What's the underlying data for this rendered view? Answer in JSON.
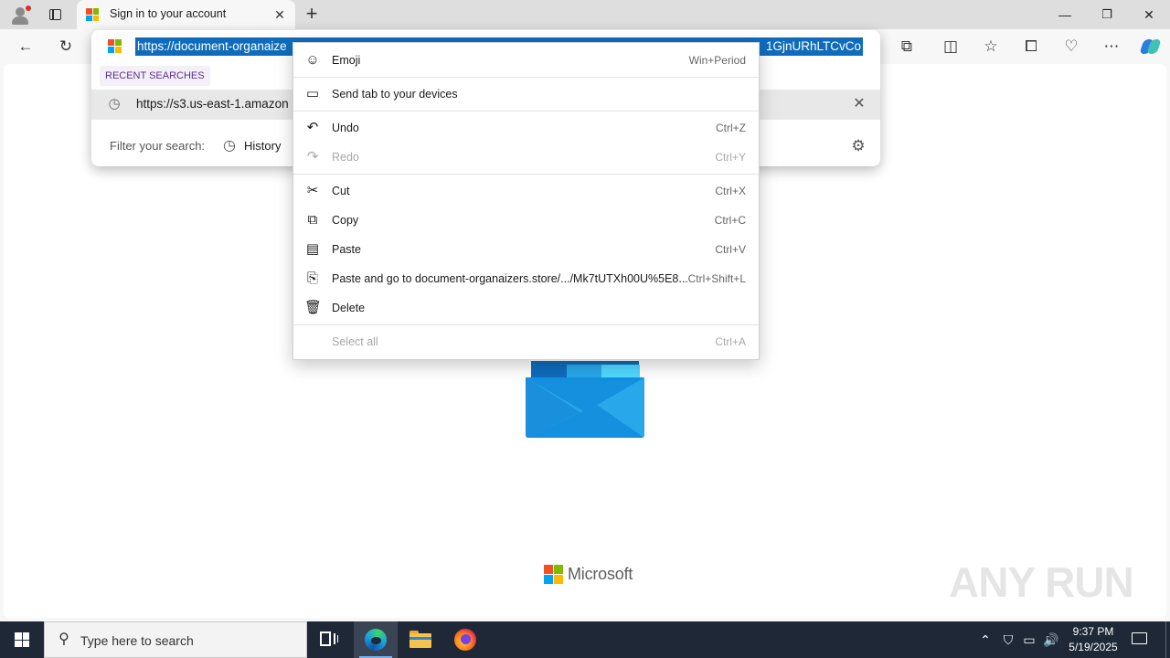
{
  "browser": {
    "tab": {
      "title": "Sign in to your account"
    },
    "window_controls": {
      "minimize": "—",
      "restore": "❐",
      "close": "✕"
    },
    "toolbar_icons": [
      "back-icon",
      "refresh-icon",
      "extensions-icon",
      "split-screen-icon",
      "favorites-icon",
      "collections-icon",
      "browser-essentials-icon",
      "more-icon",
      "copilot-icon"
    ]
  },
  "omnibox": {
    "url_start": "https://document-organaize",
    "url_end": "1GjnURhLTCvCo",
    "recent_label": "RECENT SEARCHES",
    "suggestion": "https://s3.us-east-1.amazon",
    "filter_label": "Filter your search:",
    "filter_history": "History"
  },
  "context_menu": {
    "items": [
      {
        "label": "Emoji",
        "shortcut": "Win+Period",
        "icon": "emoji-icon",
        "enabled": true
      },
      {
        "label": "Send tab to your devices",
        "shortcut": "",
        "icon": "send-tab-icon",
        "enabled": true
      },
      {
        "label": "Undo",
        "shortcut": "Ctrl+Z",
        "icon": "undo-icon",
        "enabled": true
      },
      {
        "label": "Redo",
        "shortcut": "Ctrl+Y",
        "icon": "redo-icon",
        "enabled": false
      },
      {
        "label": "Cut",
        "shortcut": "Ctrl+X",
        "icon": "cut-icon",
        "enabled": true
      },
      {
        "label": "Copy",
        "shortcut": "Ctrl+C",
        "icon": "copy-icon",
        "enabled": true
      },
      {
        "label": "Paste",
        "shortcut": "Ctrl+V",
        "icon": "paste-icon",
        "enabled": true
      },
      {
        "label": "Paste and go to document-organaizers.store/.../Mk7tUTXh00U%5E8...",
        "shortcut": "Ctrl+Shift+L",
        "icon": "paste-and-go-icon",
        "enabled": true
      },
      {
        "label": "Delete",
        "shortcut": "",
        "icon": "delete-icon",
        "enabled": true
      },
      {
        "label": "Select all",
        "shortcut": "Ctrl+A",
        "icon": "",
        "enabled": false
      }
    ]
  },
  "page": {
    "footer_brand": "Microsoft",
    "watermark": "ANY RUN"
  },
  "taskbar": {
    "search_placeholder": "Type here to search",
    "time": "9:37 PM",
    "date": "5/19/2025",
    "accent": "#0f6cbd"
  }
}
